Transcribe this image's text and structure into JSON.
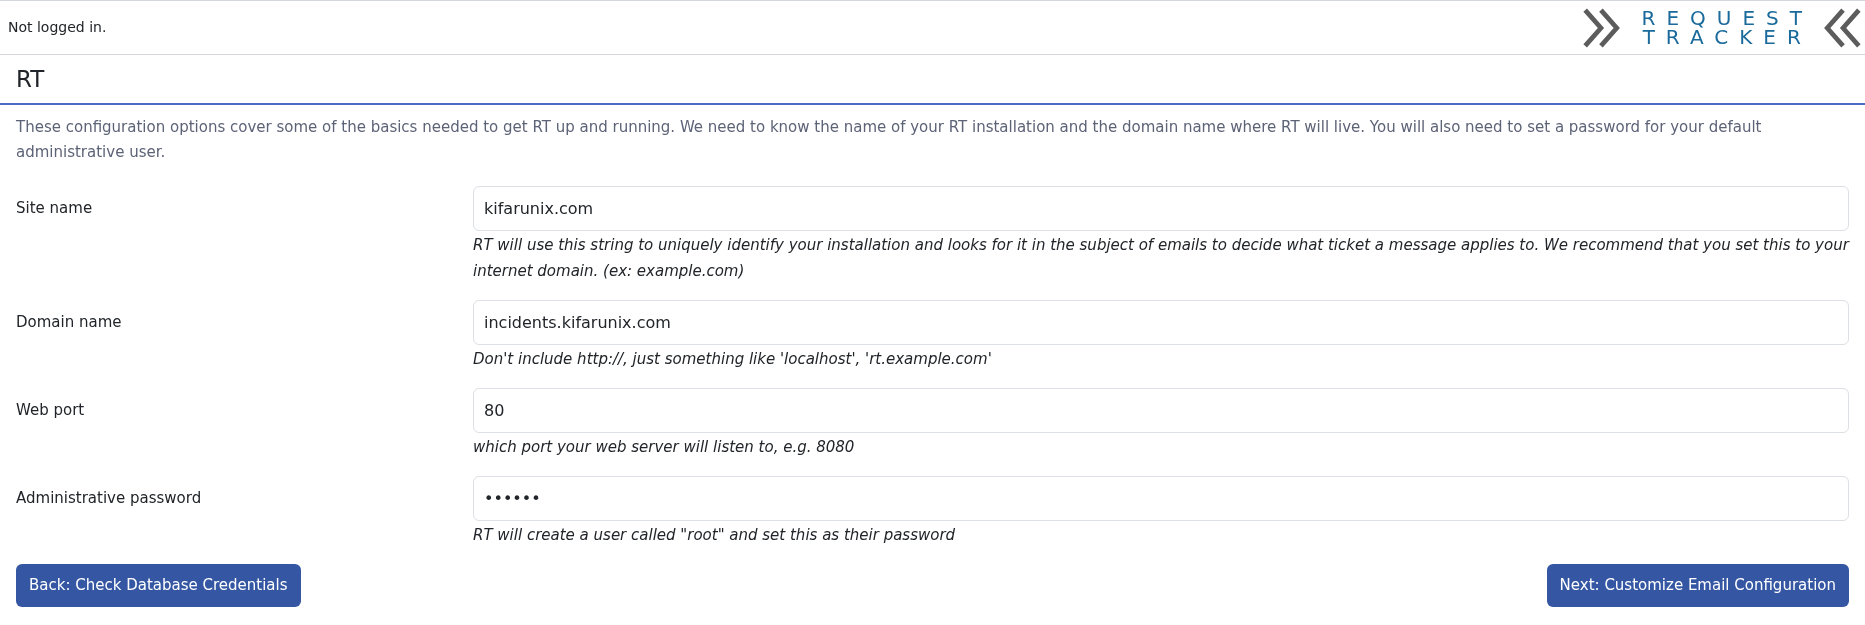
{
  "header": {
    "status": "Not logged in.",
    "logo": {
      "line_1": "REQUEST",
      "line_2": "TRACKER"
    }
  },
  "page_title": "RT",
  "intro": "These configuration options cover some of the basics needed to get RT up and running. We need to know the name of your RT installation and the domain name where RT will live. You will also need to set a password for your default administrative user.",
  "fields": [
    {
      "label": "Site name",
      "value": "kifarunix.com",
      "hint": "RT will use this string to uniquely identify your installation and looks for it in the subject of emails to decide what ticket a message applies to. We recommend that you set this to your internet domain. (ex: example.com)"
    },
    {
      "label": "Domain name",
      "value": "incidents.kifarunix.com",
      "hint": "Don't include http://, just something like 'localhost', 'rt.example.com'"
    },
    {
      "label": "Web port",
      "value": "80",
      "hint": "which port your web server will listen to, e.g. 8080"
    },
    {
      "label": "Administrative password",
      "value": "••••••",
      "hint": "RT will create a user called \"root\" and set this as their password"
    }
  ],
  "buttons": [
    {
      "label": "Back: Check Database Credentials"
    },
    {
      "label": "Next: Customize Email Configuration"
    }
  ]
}
